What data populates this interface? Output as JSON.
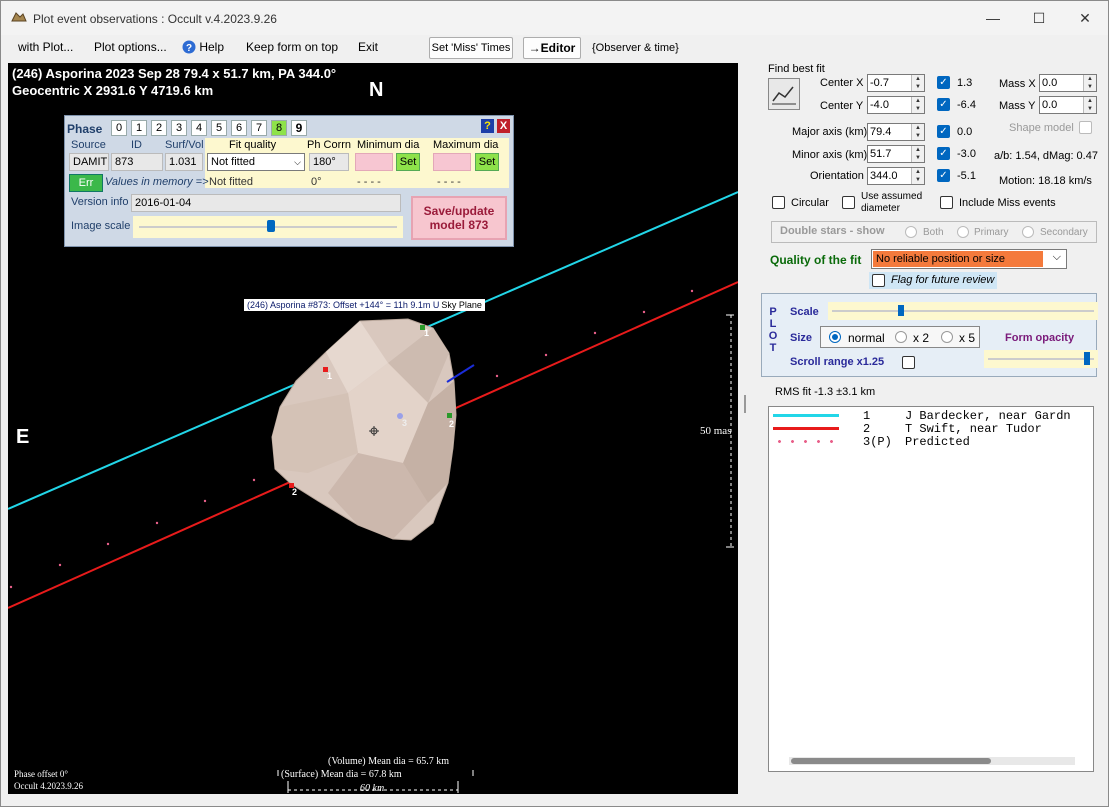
{
  "window": {
    "title": "Plot event observations : Occult v.4.2023.9.26",
    "controls": {
      "minimize": "—",
      "maximize": "☐",
      "close": "✕"
    }
  },
  "menu": {
    "with_plot": "with Plot...",
    "plot_options": "Plot options...",
    "help": "Help",
    "keep_on_top": "Keep form on top",
    "exit": "Exit",
    "set_miss_times": "Set 'Miss' Times",
    "editor": "→Editor",
    "observer_time": "{Observer & time}"
  },
  "plot": {
    "header_line1": "(246) Asporina  2023 Sep 28   79.4 x 51.7 km, PA 344.0°",
    "header_line2": "Geocentric  X  2931.6  Y 4719.6 km",
    "north": "N",
    "east": "E",
    "model_caption": "(246) Asporina #873: Offset +144° = 11h  9.1m U",
    "sky_plane": "Sky Plane",
    "scale_mas": "50 mas",
    "volume_dia": "(Volume) Mean dia = 65.7 km",
    "surface_dia": "(Surface) Mean dia = 67.8 km",
    "km_scale": "60 km",
    "phase_offset": "Phase offset 0°",
    "occult_version": "Occult 4.2023.9.26",
    "chord_labels": [
      "1",
      "2",
      "3",
      "1",
      "2"
    ],
    "colors": {
      "chord1": "#22d6e8",
      "chord2": "#e81b1b",
      "predicted": "#e8608a",
      "shape": "#d8c7bd"
    }
  },
  "phasebox": {
    "phase_label": "Phase",
    "phases": [
      "0",
      "1",
      "2",
      "3",
      "4",
      "5",
      "6",
      "7",
      "8",
      "9"
    ],
    "help_icon": "?",
    "close_icon": "X",
    "col_source": "Source",
    "col_id": "ID",
    "col_surfvol": "Surf/Vol",
    "col_fit_quality": "Fit quality",
    "col_ph_corrn": "Ph Corrn",
    "col_min_dia": "Minimum dia",
    "col_max_dia": "Maximum dia",
    "source": "DAMIT",
    "id": "873",
    "surfvol": "1.031",
    "fit_quality": "Not fitted",
    "fit_quality_memory": "Not fitted",
    "ph_corrn": "180°",
    "ph_corrn_memory": "0°",
    "min_dia_memory": "- - - -",
    "max_dia_memory": "- - - -",
    "set": "Set",
    "err": "Err",
    "values_in_memory": "Values in memory =>",
    "version_info_label": "Version info",
    "version_info": "2016-01-04",
    "image_scale_label": "Image scale",
    "save_update": "Save/update model 873"
  },
  "fit": {
    "find_best_fit": "Find best fit",
    "center_x_label": "Center X",
    "center_x": "-0.7",
    "center_x_chk": "1.3",
    "mass_x_label": "Mass X",
    "mass_x": "0.0",
    "center_y_label": "Center Y",
    "center_y": "-4.0",
    "center_y_chk": "-6.4",
    "mass_y_label": "Mass Y",
    "mass_y": "0.0",
    "major_label": "Major axis (km)",
    "major": "79.4",
    "major_chk": "0.0",
    "shape_model": "Shape model",
    "minor_label": "Minor axis (km)",
    "minor": "51.7",
    "minor_chk": "-3.0",
    "ab_dmag": "a/b: 1.54, dMag: 0.47",
    "orientation_label": "Orientation",
    "orientation": "344.0",
    "orientation_chk": "-5.1",
    "motion": "Motion: 18.18 km/s",
    "circular": "Circular",
    "use_assumed": "Use assumed diameter",
    "include_miss": "Include Miss events",
    "double_stars": "Double stars - show",
    "both": "Both",
    "primary": "Primary",
    "secondary": "Secondary",
    "quality_label": "Quality of the fit",
    "quality_value": "No reliable position or size",
    "flag_review": "Flag for future review"
  },
  "plotpanel": {
    "plot_vertical": "P L O T",
    "scale": "Scale",
    "size": "Size",
    "normal": "normal",
    "x2": "x 2",
    "x5": "x 5",
    "form_opacity": "Form opacity",
    "scroll_range": "Scroll range x1.25"
  },
  "rms": "RMS fit -1.3 ±3.1 km",
  "legend": [
    {
      "num": "1",
      "name": "J Bardecker, near Gardn",
      "color": "#22d6e8"
    },
    {
      "num": "2",
      "name": "T Swift, near Tudor",
      "color": "#e81b1b"
    },
    {
      "num": "3(P)",
      "name": "Predicted",
      "color": "#e8608a"
    }
  ]
}
